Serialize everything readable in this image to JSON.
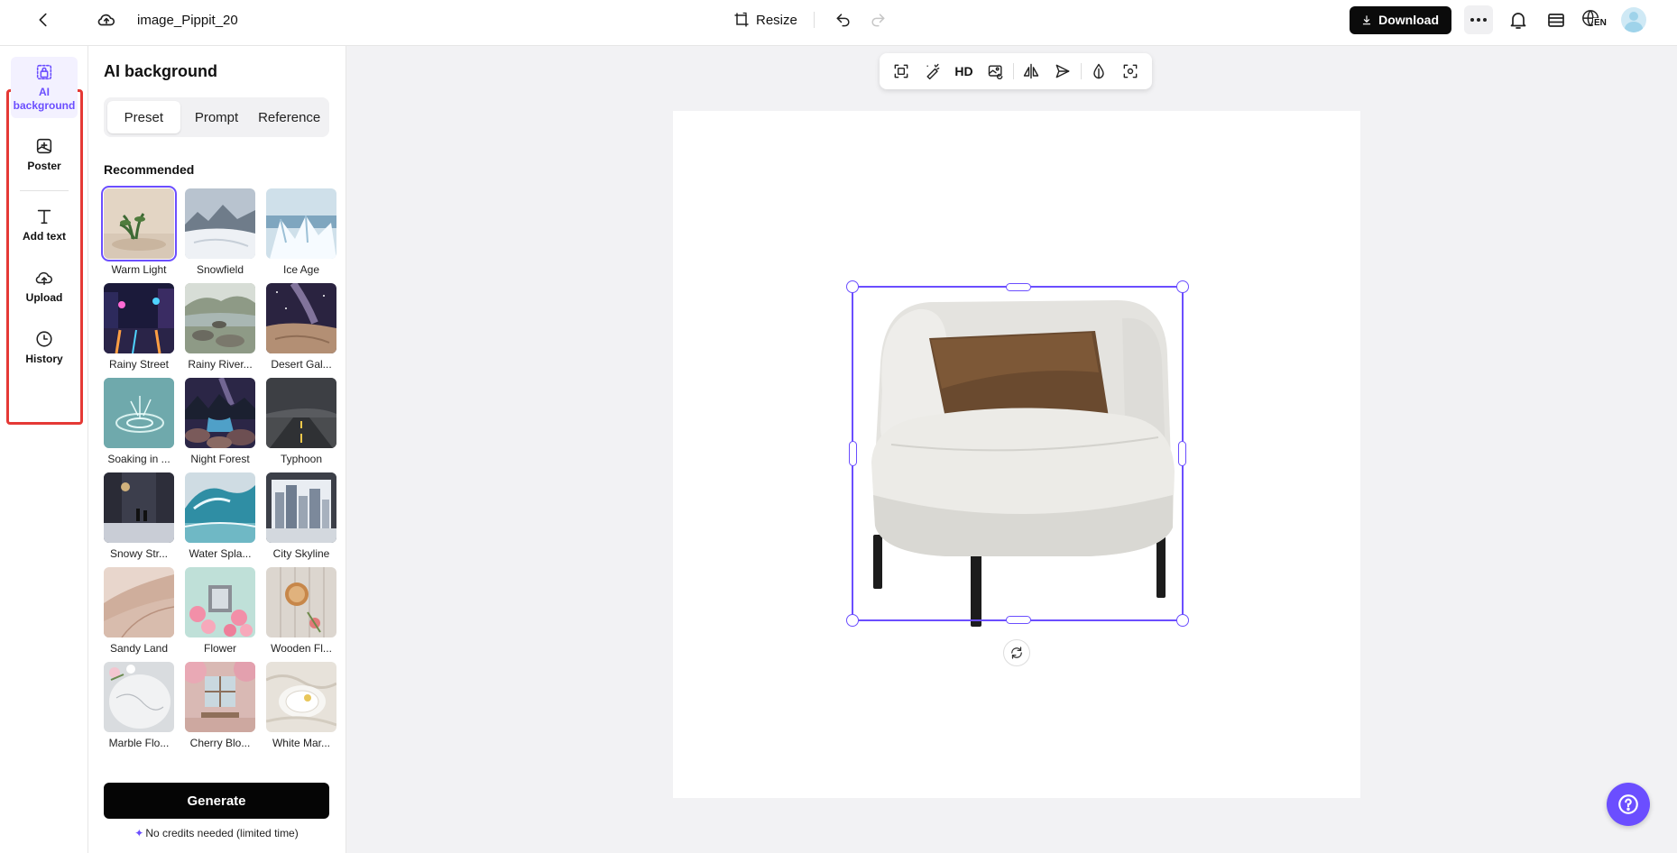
{
  "header": {
    "file_name": "image_Pippit_20",
    "resize_label": "Resize",
    "download_label": "Download",
    "language_badge": "EN",
    "icons": [
      "back-arrow-icon",
      "cloud-save-icon",
      "resize-icon",
      "undo-icon",
      "redo-icon",
      "download-icon",
      "more-icon",
      "bell-icon",
      "layers-icon",
      "globe-icon",
      "avatar"
    ]
  },
  "rail": {
    "items": [
      {
        "label": "AI background",
        "icon": "ai-background-icon",
        "active": true
      },
      {
        "label": "Poster",
        "icon": "poster-icon"
      },
      {
        "label": "Add text",
        "icon": "text-icon"
      },
      {
        "label": "Upload",
        "icon": "upload-icon"
      },
      {
        "label": "History",
        "icon": "history-icon"
      }
    ],
    "highlight_color": "#e53935"
  },
  "panel": {
    "title": "AI background",
    "tabs": [
      {
        "label": "Preset",
        "active": true
      },
      {
        "label": "Prompt"
      },
      {
        "label": "Reference"
      }
    ],
    "section_label": "Recommended",
    "presets": [
      {
        "label": "Warm Light",
        "selected": true
      },
      {
        "label": "Snowfield"
      },
      {
        "label": "Ice Age"
      },
      {
        "label": "Rainy Street"
      },
      {
        "label": "Rainy River..."
      },
      {
        "label": "Desert Gal..."
      },
      {
        "label": "Soaking in ..."
      },
      {
        "label": "Night Forest"
      },
      {
        "label": "Typhoon"
      },
      {
        "label": "Snowy Str..."
      },
      {
        "label": "Water Spla..."
      },
      {
        "label": "City Skyline"
      },
      {
        "label": "Sandy Land"
      },
      {
        "label": "Flower"
      },
      {
        "label": "Wooden Fl..."
      },
      {
        "label": "Marble Flo..."
      },
      {
        "label": "Cherry Blo..."
      },
      {
        "label": "White Mar..."
      }
    ],
    "generate_label": "Generate",
    "credits_note": "No credits needed (limited time)"
  },
  "canvas": {
    "toolbar": {
      "hd_label": "HD",
      "icons": [
        "resize-fit-icon",
        "magic-eraser-icon",
        "hd-upscale-icon",
        "replace-image-icon",
        "flip-icon",
        "send-icon",
        "opacity-icon",
        "focus-icon"
      ]
    },
    "accent_color": "#6b4eff"
  }
}
